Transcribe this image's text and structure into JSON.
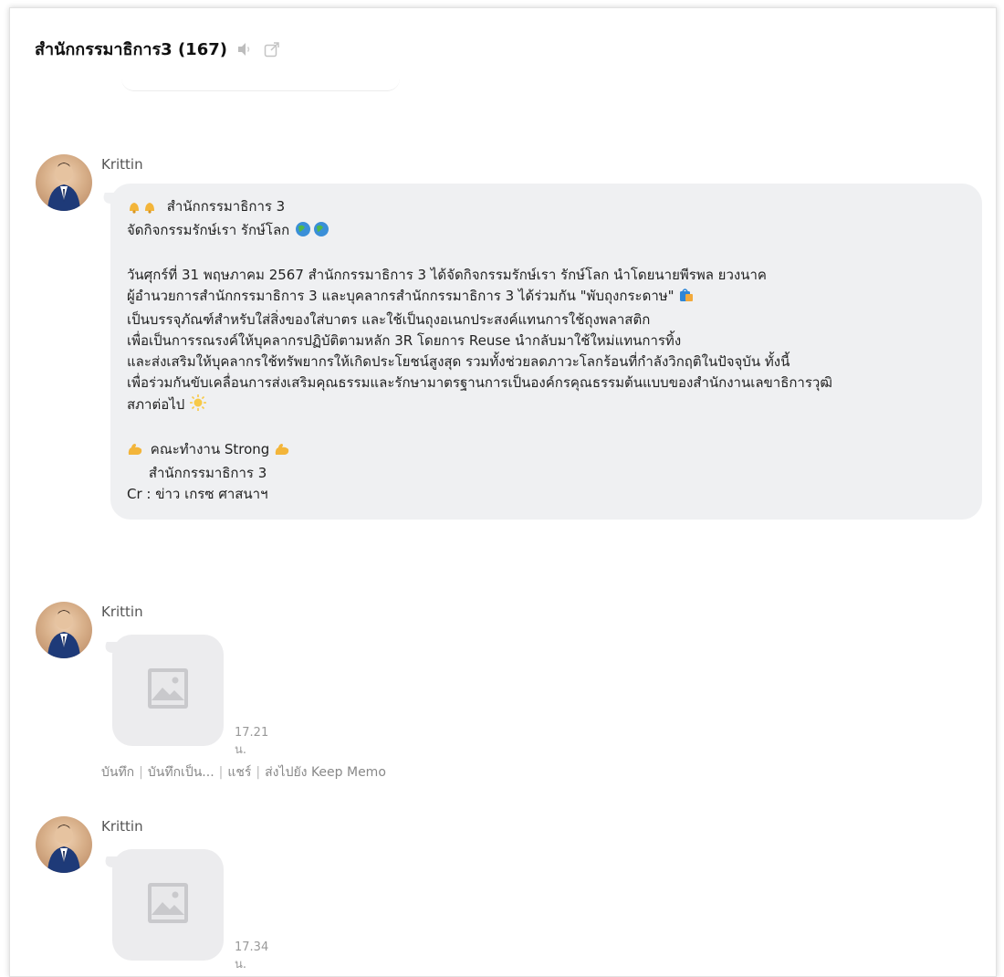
{
  "header": {
    "title": "สำนักกรรมาธิการ3 (167)",
    "mute_icon": "speaker-muted-icon",
    "popout_icon": "popout-icon"
  },
  "messages": [
    {
      "sender": "Krittin",
      "lines": [
        "สำนักกรรมาธิการ 3",
        "จัดกิจกรรมรักษ์เรา รักษ์โลก",
        "",
        "วันศุกร์ที่ 31 พฤษภาคม 2567 สำนักกรรมาธิการ 3 ได้จัดกิจกรรมรักษ์เรา รักษ์โลก นำโดยนายพีรพล  ยวงนาค",
        "ผู้อำนวยการสำนักกรรมาธิการ 3 และบุคลากรสำนักกรรมาธิการ 3 ได้ร่วมกัน \"พับถุงกระดาษ\"",
        "เป็นบรรจุภัณฑ์สำหรับใส่สิ่งของใส่บาตร และใช้เป็นถุงอเนกประสงค์แทนการใช้ถุงพลาสติก",
        "เพื่อเป็นการรณรงค์ให้บุคลากรปฏิบัติตามหลัก 3R โดยการ Reuse นำกลับมาใช้ใหม่แทนการทิ้ง",
        "และส่งเสริมให้บุคลากรใช้ทรัพยากรให้เกิดประโยชน์สูงสุด รวมทั้งช่วยลดภาวะโลกร้อนที่กำลังวิกฤติในปัจจุบัน ทั้งนี้",
        "เพื่อร่วมกันขับเคลื่อนการส่งเสริมคุณธรรมและรักษามาตรฐานการเป็นองค์กรคุณธรรมต้นแบบของสำนักงานเลขาธิการวุฒิ",
        "สภาต่อไป",
        "",
        "คณะทำงาน Strong",
        "     สำนักกรรมาธิการ 3",
        "Cr : ข่าว เกรซ ศาสนาฯ"
      ]
    },
    {
      "sender": "Krittin",
      "image_icon": "image-placeholder-icon",
      "time": "17.21 น.",
      "actions": [
        "บันทึก",
        "บันทึกเป็น...",
        "แชร์",
        "ส่งไปยัง Keep Memo"
      ]
    },
    {
      "sender": "Krittin",
      "image_icon": "image-placeholder-icon",
      "time": "17.34 น."
    }
  ],
  "colors": {
    "bubble_bg": "#eff0f2",
    "image_bg": "#ececee",
    "meta_text": "#999999"
  }
}
